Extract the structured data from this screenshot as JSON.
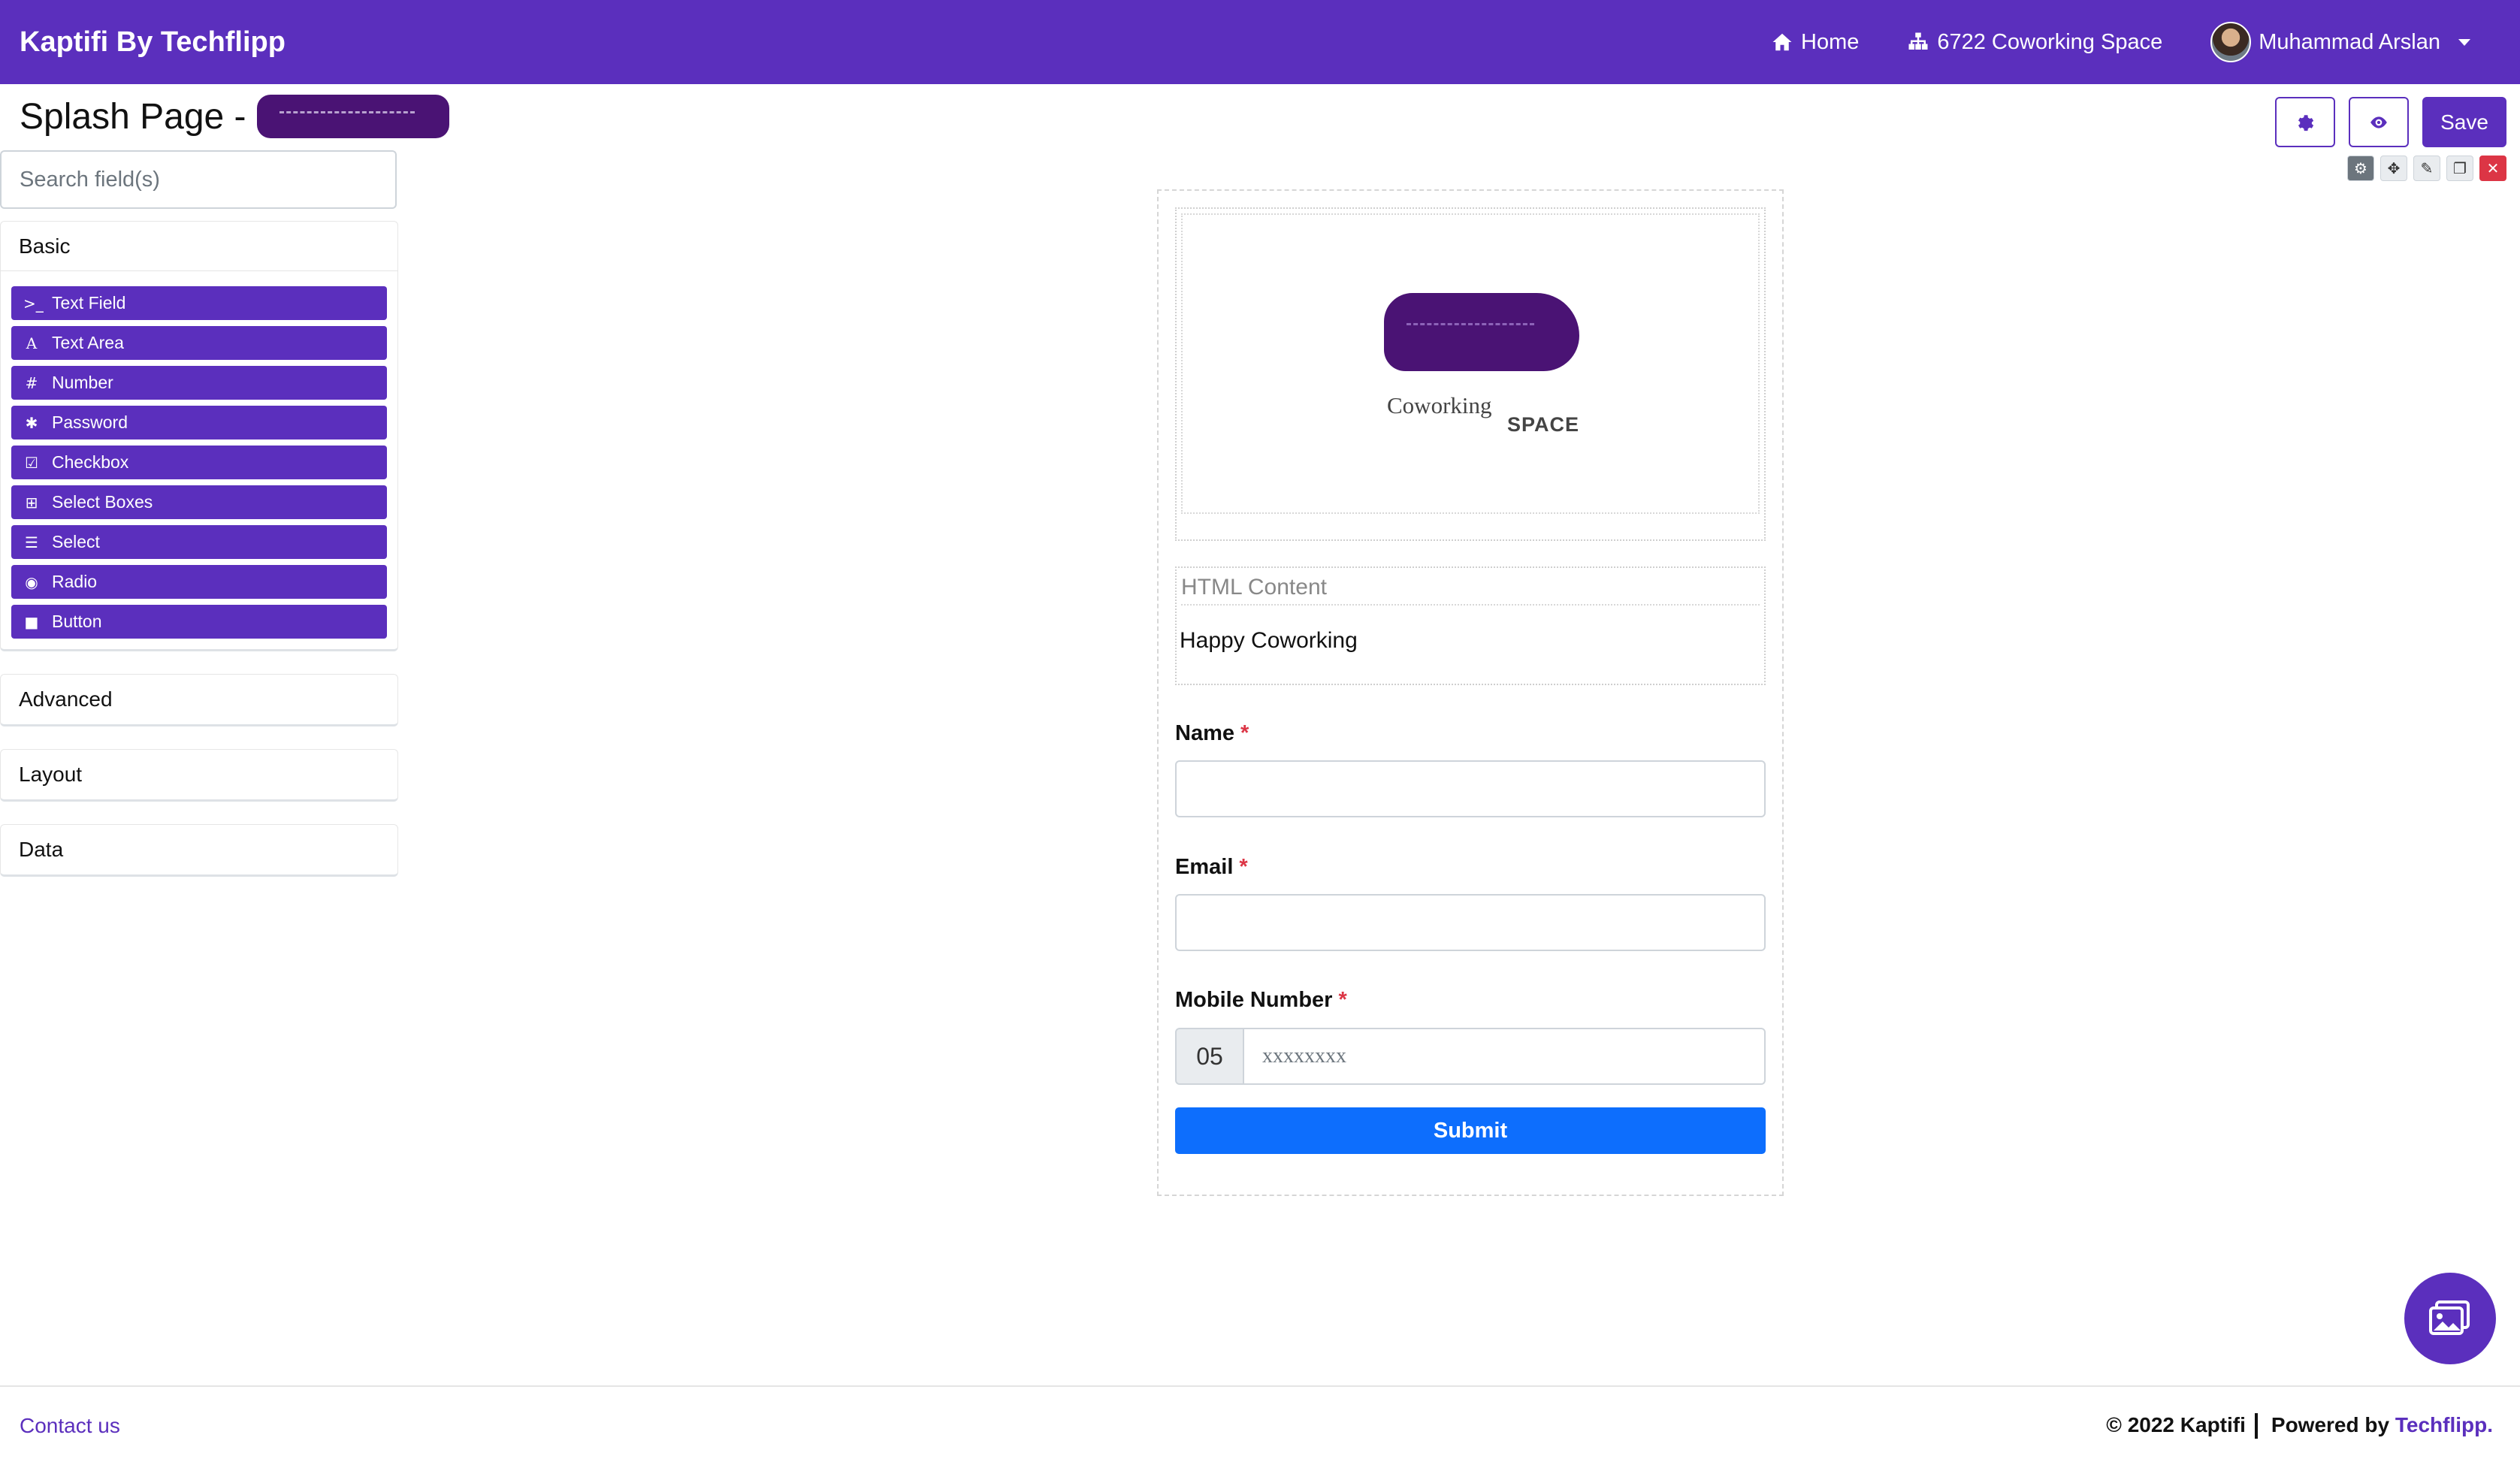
{
  "navbar": {
    "brand": "Kaptifi By Techflipp",
    "home": "Home",
    "space": "6722 Coworking Space",
    "user": "Muhammad Arslan"
  },
  "page": {
    "title": "Splash Page -"
  },
  "actions": {
    "save": "Save"
  },
  "sidebar": {
    "search_placeholder": "Search field(s)",
    "basic": "Basic",
    "fields": [
      {
        "icon": "terminal-icon",
        "label": "Text Field"
      },
      {
        "icon": "font-icon",
        "label": "Text Area"
      },
      {
        "icon": "hashtag-icon",
        "label": "Number"
      },
      {
        "icon": "asterisk-icon",
        "label": "Password"
      },
      {
        "icon": "check-square-icon",
        "label": "Checkbox"
      },
      {
        "icon": "plus-square-icon",
        "label": "Select Boxes"
      },
      {
        "icon": "list-icon",
        "label": "Select"
      },
      {
        "icon": "dot-circle-icon",
        "label": "Radio"
      },
      {
        "icon": "stop-icon",
        "label": "Button"
      }
    ],
    "advanced": "Advanced",
    "layout": "Layout",
    "data": "Data"
  },
  "form": {
    "logo_text": "Coworking",
    "logo_sub": "SPACE",
    "html_label": "HTML Content",
    "html_text": "Happy Coworking",
    "name_label": "Name",
    "email_label": "Email",
    "mobile_label": "Mobile Number",
    "required_mark": "*",
    "mobile_prefix": "05",
    "mobile_placeholder": "xxxxxxxx",
    "submit": "Submit"
  },
  "footer": {
    "contact": "Contact us",
    "copyright": "© 2022 Kaptifi",
    "powered": "Powered by",
    "powered_brand": "Techflipp."
  },
  "colors": {
    "primary": "#5b2fbd",
    "submit": "#0d6efd",
    "required": "#dc3545"
  }
}
